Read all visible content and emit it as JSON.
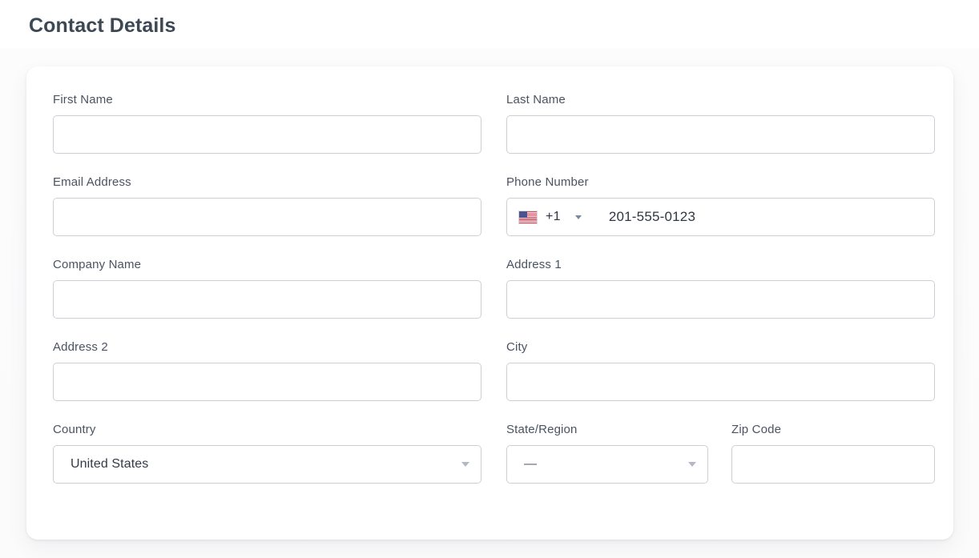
{
  "page": {
    "title": "Contact Details"
  },
  "form": {
    "rows": [
      {
        "left": {
          "label": "First Name",
          "value": "",
          "placeholder": "",
          "type": "text"
        },
        "right": {
          "label": "Last Name",
          "value": "",
          "placeholder": "",
          "type": "text"
        }
      },
      {
        "left": {
          "label": "Email Address",
          "value": "",
          "placeholder": "",
          "type": "text"
        },
        "right": {
          "label": "Phone Number",
          "type": "phone",
          "country_flag": "us-flag-icon",
          "dial_code": "+1",
          "caret": "chevron-down-icon",
          "value": "",
          "placeholder": "201-555-0123"
        }
      },
      {
        "left": {
          "label": "Company Name",
          "value": "",
          "placeholder": "",
          "type": "text"
        },
        "right": {
          "label": "Address 1",
          "value": "",
          "placeholder": "",
          "type": "text"
        }
      },
      {
        "left": {
          "label": "Address 2",
          "value": "",
          "placeholder": "",
          "type": "text"
        },
        "right": {
          "label": "City",
          "value": "",
          "placeholder": "",
          "type": "text"
        }
      }
    ],
    "country": {
      "label": "Country",
      "selected": "United States",
      "arrow": "chevron-down-icon"
    },
    "state": {
      "label": "State/Region",
      "selected": "—",
      "arrow": "chevron-down-icon"
    },
    "zip": {
      "label": "Zip Code",
      "value": "",
      "placeholder": ""
    }
  },
  "colors": {
    "title_text": "#3d4855",
    "label_text": "#4b5362",
    "input_border": "#ccd0d6",
    "input_text": "#2f3642",
    "card_bg": "#ffffff",
    "page_bg": "#fbfbfc",
    "select_arrow": "#b3b9c4",
    "phone_caret": "#7a87a0",
    "flag_red": "#cf4a5c",
    "flag_blue": "#4b558c"
  }
}
